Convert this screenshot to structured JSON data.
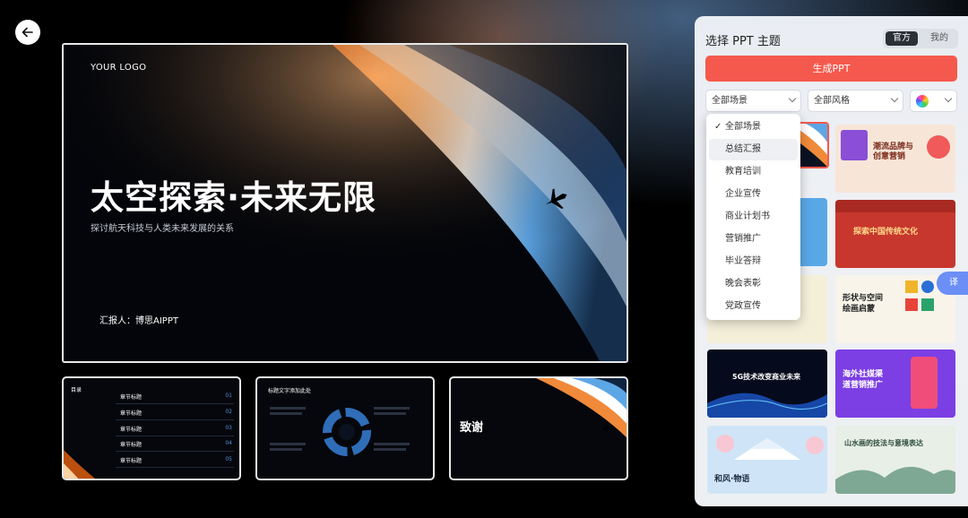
{
  "back_button": {
    "icon": "arrow-left-icon"
  },
  "main_slide": {
    "logo": "YOUR LOGO",
    "title": "太空探索·未来无限",
    "subtitle": "探讨航天科技与人类未来发展的关系",
    "reporter": "汇报人：博思AIPPT"
  },
  "thumbnails": {
    "toc": {
      "title": "目录",
      "rows": [
        {
          "label": "章节标题",
          "num": "01"
        },
        {
          "label": "章节标题",
          "num": "02"
        },
        {
          "label": "章节标题",
          "num": "03"
        },
        {
          "label": "章节标题",
          "num": "04"
        },
        {
          "label": "章节标题",
          "num": "05"
        }
      ]
    },
    "content": {
      "title": "标题文字添加此处"
    },
    "thanks": {
      "title": "致谢"
    }
  },
  "panel": {
    "title": "选择 PPT 主题",
    "tabs": {
      "official": "官方",
      "mine": "我的",
      "active": "官方"
    },
    "generate_label": "生成PPT",
    "filters": {
      "scene": "全部场景",
      "style": "全部风格"
    },
    "dropdown": {
      "items": [
        "全部场景",
        "总结汇报",
        "教育培训",
        "企业宣传",
        "商业计划书",
        "营销推广",
        "毕业答辩",
        "晚会表彰",
        "党政宣传"
      ],
      "selected": "全部场景",
      "hovered": "总结汇报"
    },
    "templates": [
      {
        "label": "潮流品牌与\n创意营销"
      },
      {
        "label": "探索中国传统文化"
      },
      {
        "label": "形状与空间\n绘画启蒙"
      },
      {
        "label": "5G技术改变商业未来"
      },
      {
        "label": "海外社媒渠\n道营销推广"
      },
      {
        "label": "和风·物语"
      },
      {
        "label": "山水画的技法与意境表达"
      }
    ],
    "side_tab": "译"
  }
}
